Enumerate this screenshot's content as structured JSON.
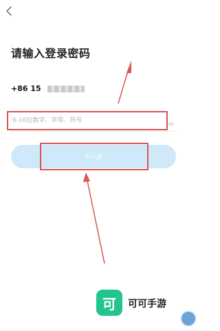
{
  "header": {
    "back_icon": "chevron-left-icon"
  },
  "title": "请输入登录密码",
  "phone": {
    "prefix": "+86 15",
    "masked": true
  },
  "password_field": {
    "placeholder": "6-16位数字、字母、符号",
    "value": ""
  },
  "next_button": {
    "label": "下一步"
  },
  "watermark": {
    "logo_text": "可",
    "name": "可可手游",
    "logo_color": "#24c48e"
  },
  "colors": {
    "accent": "#d9534f",
    "button_bg": "#cfe9fb"
  }
}
